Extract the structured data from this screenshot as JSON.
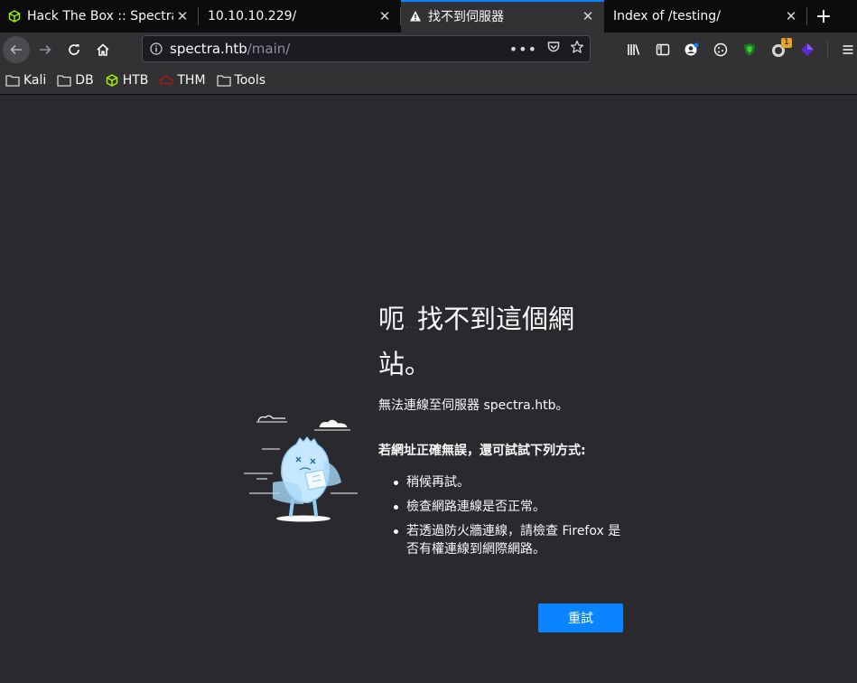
{
  "tabs": [
    {
      "title": "Hack The Box :: Spectra",
      "icon": "htb-cube-icon",
      "active": false
    },
    {
      "title": "10.10.10.229/",
      "icon": "",
      "active": false
    },
    {
      "title": "找不到伺服器",
      "icon": "warning-icon",
      "active": true
    },
    {
      "title": "Index of /testing/",
      "icon": "",
      "active": false
    }
  ],
  "new_tab_label": "+",
  "url": {
    "host": "spectra.htb",
    "path": "/main/"
  },
  "bookmarks": [
    {
      "label": "Kali",
      "icon": "folder-icon"
    },
    {
      "label": "DB",
      "icon": "folder-icon"
    },
    {
      "label": "HTB",
      "icon": "htb-cube-icon"
    },
    {
      "label": "THM",
      "icon": "thm-icon"
    },
    {
      "label": "Tools",
      "icon": "folder-icon"
    }
  ],
  "extension_badge": "1",
  "error": {
    "title_part1": "呃",
    "title_ellipsis": "…",
    "title_part2": "找不到這個網站。",
    "description": "無法連線至伺服器 spectra.htb。",
    "suggestion_heading": "若網址正確無誤，還可試試下列方式:",
    "suggestions": [
      "稍候再試。",
      "檢查網路連線是否正常。",
      "若透過防火牆連線，請檢查 Firefox 是否有權連線到網際網路。"
    ],
    "retry_label": "重試"
  },
  "colors": {
    "accent": "#0a84ff",
    "background": "#2a2a2e",
    "toolbar": "#323234",
    "tabstrip": "#0c0c0d",
    "htb_green": "#9fef00"
  }
}
